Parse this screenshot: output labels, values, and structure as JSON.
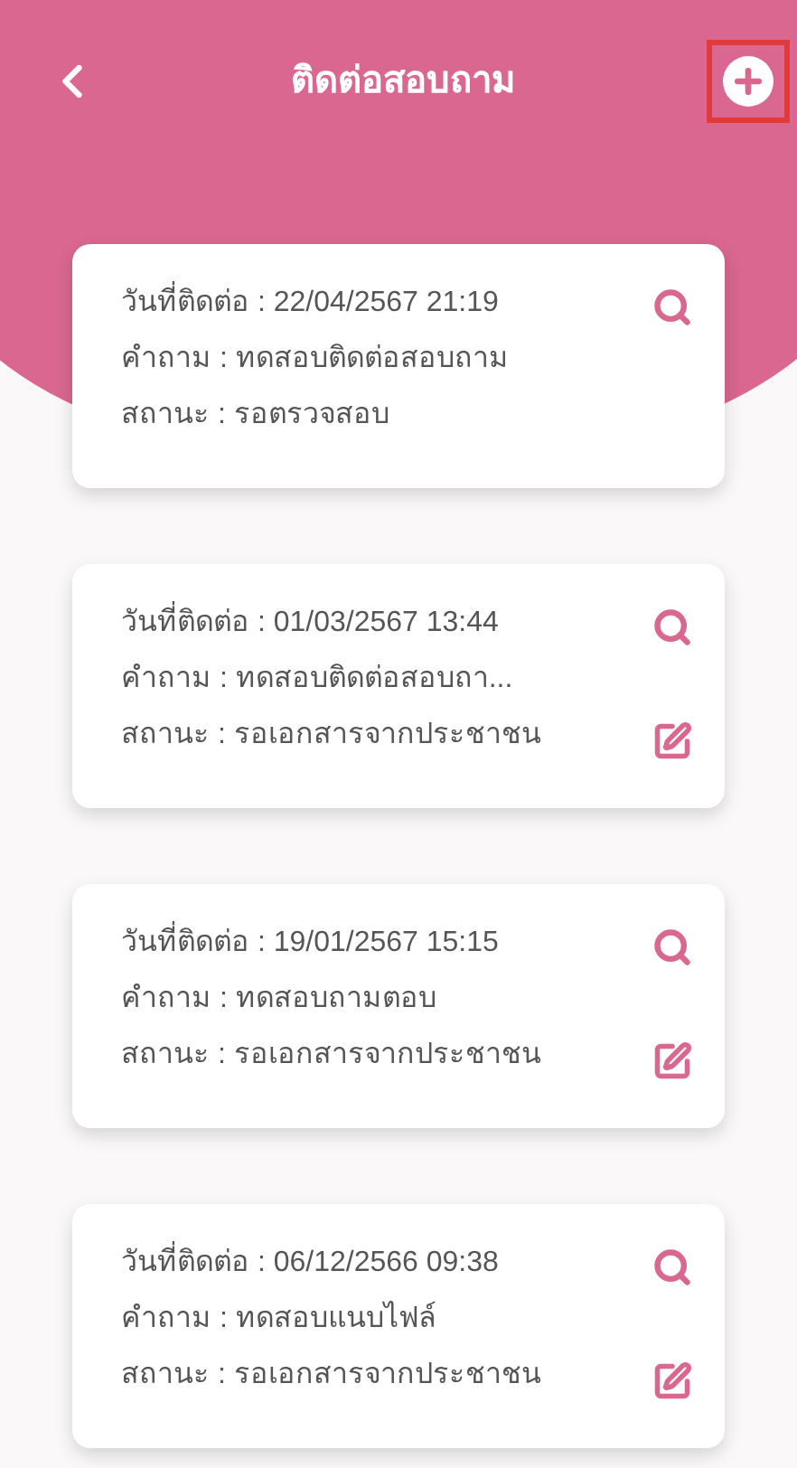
{
  "header": {
    "title": "ติดต่อสอบถาม",
    "add_button_highlighted": true
  },
  "inquiries": [
    {
      "date": "วันที่ติดต่อ : 22/04/2567 21:19",
      "question": "คำถาม : ทดสอบติดต่อสอบถาม",
      "status": "สถานะ : รอตรวจสอบ",
      "editable": false
    },
    {
      "date": "วันที่ติดต่อ : 01/03/2567 13:44",
      "question": "คำถาม : ทดสอบติดต่อสอบถา...",
      "status": "สถานะ : รอเอกสารจากประชาชน",
      "editable": true
    },
    {
      "date": "วันที่ติดต่อ : 19/01/2567 15:15",
      "question": "คำถาม : ทดสอบถามตอบ",
      "status": "สถานะ : รอเอกสารจากประชาชน",
      "editable": true
    },
    {
      "date": "วันที่ติดต่อ : 06/12/2566 09:38",
      "question": "คำถาม : ทดสอบแนบไฟล์",
      "status": "สถานะ : รอเอกสารจากประชาชน",
      "editable": true
    }
  ]
}
